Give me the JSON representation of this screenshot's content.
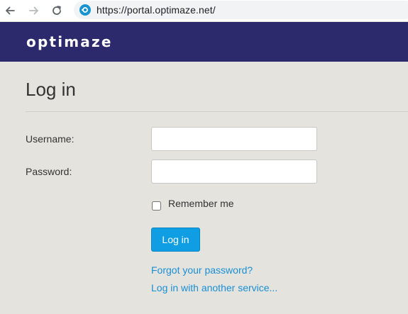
{
  "browser": {
    "url": "https://portal.optimaze.net/",
    "back_icon": "arrow-left",
    "forward_icon": "arrow-right",
    "reload_icon": "reload"
  },
  "header": {
    "logo_text": "optimaze",
    "background_color": "#2c2a6c"
  },
  "login": {
    "title": "Log in",
    "username_label": "Username:",
    "username_value": "",
    "password_label": "Password:",
    "password_value": "",
    "remember_label": "Remember me",
    "remember_checked": false,
    "submit_label": "Log in",
    "forgot_link": "Forgot your password?",
    "other_service_link": "Log in with another service..."
  },
  "colors": {
    "accent": "#0f9ee3",
    "link": "#1a8fd6",
    "page_background": "#e4e3dd"
  }
}
